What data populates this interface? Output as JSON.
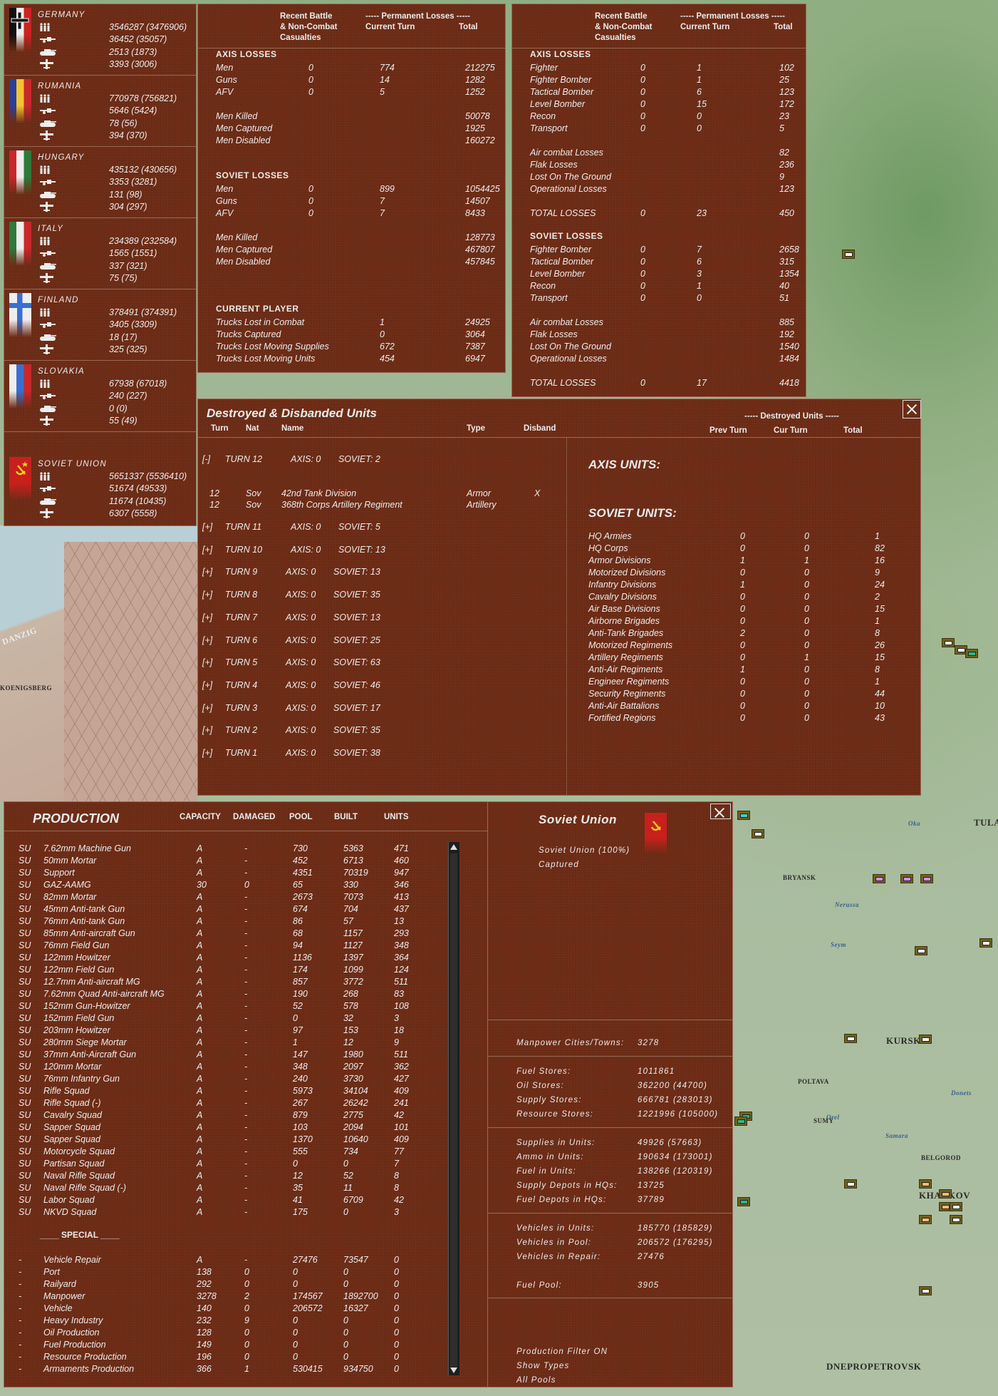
{
  "nations": [
    {
      "name": "GERMANY",
      "flag": "germany",
      "values": [
        "3546287 (3476906)",
        "36452 (35057)",
        "2513 (1873)",
        "3393 (3006)"
      ]
    },
    {
      "name": "RUMANIA",
      "flag": "rumania",
      "values": [
        "770978 (756821)",
        "5646 (5424)",
        "78 (56)",
        "394 (370)"
      ]
    },
    {
      "name": "HUNGARY",
      "flag": "hungary",
      "values": [
        "435132 (430656)",
        "3353 (3281)",
        "131 (98)",
        "304 (297)"
      ]
    },
    {
      "name": "ITALY",
      "flag": "italy",
      "values": [
        "234389 (232584)",
        "1565 (1551)",
        "337 (321)",
        "75 (75)"
      ]
    },
    {
      "name": "FINLAND",
      "flag": "finland",
      "values": [
        "378491 (374391)",
        "3405 (3309)",
        "18 (17)",
        "325 (325)"
      ]
    },
    {
      "name": "SLOVAKIA",
      "flag": "slovakia",
      "values": [
        "67938 (67018)",
        "240 (227)",
        "0 (0)",
        "55 (49)"
      ]
    },
    {
      "name": "SOVIET UNION",
      "flag": "soviet",
      "values": [
        "5651337 (5536410)",
        "51674 (49533)",
        "11674 (10435)",
        "6307 (5558)"
      ]
    }
  ],
  "nation_icons": [
    "men-icon",
    "gun-icon",
    "tank-icon",
    "plane-icon"
  ],
  "loss_headers": {
    "battle": [
      "Recent Battle",
      "& Non-Combat",
      "Casualties"
    ],
    "permanent": "----- Permanent Losses -----",
    "current": "Current Turn",
    "total": "Total"
  },
  "ground_losses": [
    {
      "title": "AXIS LOSSES",
      "groups": [
        [
          [
            "Men",
            "0",
            "774",
            "212275"
          ],
          [
            "Guns",
            "0",
            "14",
            "1282"
          ],
          [
            "AFV",
            "0",
            "5",
            "1252"
          ]
        ],
        [
          [
            "Men Killed",
            "",
            "",
            "50078"
          ],
          [
            "Men Captured",
            "",
            "",
            "1925"
          ],
          [
            "Men Disabled",
            "",
            "",
            "160272"
          ]
        ]
      ]
    },
    {
      "title": "SOVIET LOSSES",
      "groups": [
        [
          [
            "Men",
            "0",
            "899",
            "1054425"
          ],
          [
            "Guns",
            "0",
            "7",
            "14507"
          ],
          [
            "AFV",
            "0",
            "7",
            "8433"
          ]
        ],
        [
          [
            "Men Killed",
            "",
            "",
            "128773"
          ],
          [
            "Men Captured",
            "",
            "",
            "467807"
          ],
          [
            "Men Disabled",
            "",
            "",
            "457845"
          ]
        ]
      ]
    },
    {
      "title": "CURRENT PLAYER",
      "groups": [
        [
          [
            "Trucks Lost in Combat",
            "",
            "1",
            "24925"
          ],
          [
            "Trucks Captured",
            "",
            "0",
            "3064"
          ],
          [
            "Trucks Lost Moving Supplies",
            "",
            "672",
            "7387"
          ],
          [
            "Trucks Lost Moving Units",
            "",
            "454",
            "6947"
          ]
        ]
      ]
    }
  ],
  "air_losses": [
    {
      "title": "AXIS LOSSES",
      "groups": [
        [
          [
            "Fighter",
            "0",
            "1",
            "102"
          ],
          [
            "Fighter Bomber",
            "0",
            "1",
            "25"
          ],
          [
            "Tactical Bomber",
            "0",
            "6",
            "123"
          ],
          [
            "Level Bomber",
            "0",
            "15",
            "172"
          ],
          [
            "Recon",
            "0",
            "0",
            "23"
          ],
          [
            "Transport",
            "0",
            "0",
            "5"
          ]
        ],
        [
          [
            "Air combat Losses",
            "",
            "",
            "82"
          ],
          [
            "Flak Losses",
            "",
            "",
            "236"
          ],
          [
            "Lost On The Ground",
            "",
            "",
            "9"
          ],
          [
            "Operational Losses",
            "",
            "",
            "123"
          ]
        ],
        [
          [
            "TOTAL LOSSES",
            "0",
            "23",
            "450"
          ]
        ]
      ]
    },
    {
      "title": "SOVIET LOSSES",
      "groups": [
        [
          [
            "Fighter Bomber",
            "0",
            "7",
            "2658"
          ],
          [
            "Tactical Bomber",
            "0",
            "6",
            "315"
          ],
          [
            "Level Bomber",
            "0",
            "3",
            "1354"
          ],
          [
            "Recon",
            "0",
            "1",
            "40"
          ],
          [
            "Transport",
            "0",
            "0",
            "51"
          ]
        ],
        [
          [
            "Air combat Losses",
            "",
            "",
            "885"
          ],
          [
            "Flak Losses",
            "",
            "",
            "192"
          ],
          [
            "Lost On The Ground",
            "",
            "",
            "1540"
          ],
          [
            "Operational Losses",
            "",
            "",
            "1484"
          ]
        ],
        [
          [
            "TOTAL LOSSES",
            "0",
            "17",
            "4418"
          ]
        ]
      ]
    }
  ],
  "destroyed": {
    "title": "Destroyed & Disbanded Units",
    "columns": [
      "Turn",
      "Nat",
      "Name",
      "Type",
      "Disband"
    ],
    "turns": [
      {
        "toggle": "[-]",
        "turn": 12,
        "label": "TURN 12",
        "axis": "AXIS: 0",
        "soviet": "SOVIET: 2",
        "units": [
          [
            "12",
            "Sov",
            "42nd Tank Division",
            "Armor",
            "X"
          ],
          [
            "12",
            "Sov",
            "368th Corps Artillery Regiment",
            "Artillery",
            ""
          ]
        ]
      },
      {
        "toggle": "[+]",
        "turn": 11,
        "label": "TURN 11",
        "axis": "AXIS: 0",
        "soviet": "SOVIET: 5"
      },
      {
        "toggle": "[+]",
        "turn": 10,
        "label": "TURN 10",
        "axis": "AXIS: 0",
        "soviet": "SOVIET: 13"
      },
      {
        "toggle": "[+]",
        "turn": 9,
        "label": "TURN 9",
        "axis": "AXIS: 0",
        "soviet": "SOVIET: 13"
      },
      {
        "toggle": "[+]",
        "turn": 8,
        "label": "TURN 8",
        "axis": "AXIS: 0",
        "soviet": "SOVIET: 35"
      },
      {
        "toggle": "[+]",
        "turn": 7,
        "label": "TURN 7",
        "axis": "AXIS: 0",
        "soviet": "SOVIET: 13"
      },
      {
        "toggle": "[+]",
        "turn": 6,
        "label": "TURN 6",
        "axis": "AXIS: 0",
        "soviet": "SOVIET: 25"
      },
      {
        "toggle": "[+]",
        "turn": 5,
        "label": "TURN 5",
        "axis": "AXIS: 0",
        "soviet": "SOVIET: 63"
      },
      {
        "toggle": "[+]",
        "turn": 4,
        "label": "TURN 4",
        "axis": "AXIS: 0",
        "soviet": "SOVIET: 46"
      },
      {
        "toggle": "[+]",
        "turn": 3,
        "label": "TURN 3",
        "axis": "AXIS: 0",
        "soviet": "SOVIET: 17"
      },
      {
        "toggle": "[+]",
        "turn": 2,
        "label": "TURN 2",
        "axis": "AXIS: 0",
        "soviet": "SOVIET: 35"
      },
      {
        "toggle": "[+]",
        "turn": 1,
        "label": "TURN 1",
        "axis": "AXIS: 0",
        "soviet": "SOVIET: 38"
      }
    ],
    "summary_header": "----- Destroyed Units -----",
    "summary_columns": [
      "Prev Turn",
      "Cur Turn",
      "Total"
    ],
    "axis_title": "AXIS UNITS:",
    "soviet_title": "SOVIET UNITS:",
    "soviet_rows": [
      [
        "HQ Armies",
        "0",
        "0",
        "1"
      ],
      [
        "HQ Corps",
        "0",
        "0",
        "82"
      ],
      [
        "Armor Divisions",
        "1",
        "1",
        "16"
      ],
      [
        "Motorized Divisions",
        "0",
        "0",
        "9"
      ],
      [
        "Infantry Divisions",
        "1",
        "0",
        "24"
      ],
      [
        "Cavalry Divisions",
        "0",
        "0",
        "2"
      ],
      [
        "Air Base Divisions",
        "0",
        "0",
        "15"
      ],
      [
        "Airborne Brigades",
        "0",
        "0",
        "1"
      ],
      [
        "Anti-Tank Brigades",
        "2",
        "0",
        "8"
      ],
      [
        "Motorized Regiments",
        "0",
        "0",
        "26"
      ],
      [
        "Artillery Regiments",
        "0",
        "1",
        "15"
      ],
      [
        "Anti-Air Regiments",
        "1",
        "0",
        "8"
      ],
      [
        "Engineer Regiments",
        "0",
        "0",
        "1"
      ],
      [
        "Security Regiments",
        "0",
        "0",
        "44"
      ],
      [
        "Anti-Air Battalions",
        "0",
        "0",
        "10"
      ],
      [
        "Fortified Regions",
        "0",
        "0",
        "43"
      ]
    ]
  },
  "production": {
    "title": "PRODUCTION",
    "columns": [
      "CAPACITY",
      "DAMAGED",
      "POOL",
      "BUILT",
      "UNITS"
    ],
    "rows": [
      [
        "SU",
        "7.62mm Machine Gun",
        "A",
        "-",
        "730",
        "5363",
        "471"
      ],
      [
        "SU",
        "50mm Mortar",
        "A",
        "-",
        "452",
        "6713",
        "460"
      ],
      [
        "SU",
        "Support",
        "A",
        "-",
        "4351",
        "70319",
        "947"
      ],
      [
        "SU",
        "GAZ-AAMG",
        "30",
        "0",
        "65",
        "330",
        "346"
      ],
      [
        "SU",
        "82mm Mortar",
        "A",
        "-",
        "2673",
        "7073",
        "413"
      ],
      [
        "SU",
        "45mm Anti-tank Gun",
        "A",
        "-",
        "674",
        "704",
        "437"
      ],
      [
        "SU",
        "76mm Anti-tank Gun",
        "A",
        "-",
        "86",
        "57",
        "13"
      ],
      [
        "SU",
        "85mm Anti-aircraft Gun",
        "A",
        "-",
        "68",
        "1157",
        "293"
      ],
      [
        "SU",
        "76mm Field Gun",
        "A",
        "-",
        "94",
        "1127",
        "348"
      ],
      [
        "SU",
        "122mm Howitzer",
        "A",
        "-",
        "1136",
        "1397",
        "364"
      ],
      [
        "SU",
        "122mm Field Gun",
        "A",
        "-",
        "174",
        "1099",
        "124"
      ],
      [
        "SU",
        "12.7mm Anti-aircraft MG",
        "A",
        "-",
        "857",
        "3772",
        "511"
      ],
      [
        "SU",
        "7.62mm Quad Anti-aircraft MG",
        "A",
        "-",
        "190",
        "268",
        "83"
      ],
      [
        "SU",
        "152mm Gun-Howitzer",
        "A",
        "-",
        "52",
        "578",
        "108"
      ],
      [
        "SU",
        "152mm Field Gun",
        "A",
        "-",
        "0",
        "32",
        "3"
      ],
      [
        "SU",
        "203mm Howitzer",
        "A",
        "-",
        "97",
        "153",
        "18"
      ],
      [
        "SU",
        "280mm Siege Mortar",
        "A",
        "-",
        "1",
        "12",
        "9"
      ],
      [
        "SU",
        "37mm Anti-Aircraft Gun",
        "A",
        "-",
        "147",
        "1980",
        "511"
      ],
      [
        "SU",
        "120mm Mortar",
        "A",
        "-",
        "348",
        "2097",
        "362"
      ],
      [
        "SU",
        "76mm Infantry Gun",
        "A",
        "-",
        "240",
        "3730",
        "427"
      ],
      [
        "SU",
        "Rifle Squad",
        "A",
        "-",
        "5973",
        "34104",
        "409"
      ],
      [
        "SU",
        "Rifle Squad (-)",
        "A",
        "-",
        "267",
        "26242",
        "241"
      ],
      [
        "SU",
        "Cavalry Squad",
        "A",
        "-",
        "879",
        "2775",
        "42"
      ],
      [
        "SU",
        "Sapper Squad",
        "A",
        "-",
        "103",
        "2094",
        "101"
      ],
      [
        "SU",
        "Sapper Squad",
        "A",
        "-",
        "1370",
        "10640",
        "409"
      ],
      [
        "SU",
        "Motorcycle Squad",
        "A",
        "-",
        "555",
        "734",
        "77"
      ],
      [
        "SU",
        "Partisan Squad",
        "A",
        "-",
        "0",
        "0",
        "7"
      ],
      [
        "SU",
        "Naval Rifle Squad",
        "A",
        "-",
        "12",
        "52",
        "8"
      ],
      [
        "SU",
        "Naval Rifle Squad (-)",
        "A",
        "-",
        "35",
        "11",
        "8"
      ],
      [
        "SU",
        "Labor Squad",
        "A",
        "-",
        "41",
        "6709",
        "42"
      ],
      [
        "SU",
        "NKVD Squad",
        "A",
        "-",
        "175",
        "0",
        "3"
      ]
    ],
    "special_title": "____ SPECIAL ____",
    "special_rows": [
      [
        "-",
        "Vehicle Repair",
        "A",
        "-",
        "27476",
        "73547",
        "0"
      ],
      [
        "-",
        "Port",
        "138",
        "0",
        "0",
        "0",
        "0"
      ],
      [
        "-",
        "Railyard",
        "292",
        "0",
        "0",
        "0",
        "0"
      ],
      [
        "-",
        "Manpower",
        "3278",
        "2",
        "174567",
        "1892700",
        "0"
      ],
      [
        "-",
        "Vehicle",
        "140",
        "0",
        "206572",
        "16327",
        "0"
      ],
      [
        "-",
        "Heavy Industry",
        "232",
        "9",
        "0",
        "0",
        "0"
      ],
      [
        "-",
        "Oil Production",
        "128",
        "0",
        "0",
        "0",
        "0"
      ],
      [
        "-",
        "Fuel Production",
        "149",
        "0",
        "0",
        "0",
        "0"
      ],
      [
        "-",
        "Resource Production",
        "196",
        "0",
        "0",
        "0",
        "0"
      ],
      [
        "-",
        "Armaments Production",
        "366",
        "1",
        "530415",
        "934750",
        "0"
      ]
    ]
  },
  "nation_info": {
    "title": "Soviet Union",
    "subtitle": "Soviet Union  (100%)",
    "status": "Captured",
    "groups": [
      [
        [
          "Manpower Cities/Towns:",
          "3278"
        ]
      ],
      [
        [
          "Fuel Stores:",
          "1011861"
        ],
        [
          "Oil Stores:",
          "362200 (44700)"
        ],
        [
          "Supply Stores:",
          "666781 (283013)"
        ],
        [
          "Resource Stores:",
          "1221996 (105000)"
        ]
      ],
      [
        [
          "Supplies in Units:",
          "49926 (57663)"
        ],
        [
          "Ammo in Units:",
          "190634 (173001)"
        ],
        [
          "Fuel in Units:",
          "138266 (120319)"
        ],
        [
          "Supply Depots in HQs:",
          "13725"
        ],
        [
          "Fuel Depots in HQs:",
          "37789"
        ]
      ],
      [
        [
          "Vehicles in Units:",
          "185770 (185829)"
        ],
        [
          "Vehicles in Pool:",
          "206572 (176295)"
        ],
        [
          "Vehicles in Repair:",
          "27476"
        ],
        [
          "",
          ""
        ],
        [
          "Fuel Pool:",
          "3905"
        ]
      ]
    ],
    "options": [
      "Production Filter ON",
      "Show Types",
      "All Pools"
    ]
  },
  "map_labels": [
    "DANZIG",
    "KOENIGSBERG",
    "BRYANSK",
    "KURSK",
    "SUMY",
    "BELGOROD",
    "KHARKOV",
    "POLTAVA",
    "DNEPROPETROVSK",
    "TULA",
    "Nerussa",
    "Seym",
    "Orel",
    "Donets",
    "Samara",
    "Oka"
  ],
  "colors": {
    "panel": "#6a2b16",
    "text": "#ececec",
    "map": "#a9b99c"
  }
}
